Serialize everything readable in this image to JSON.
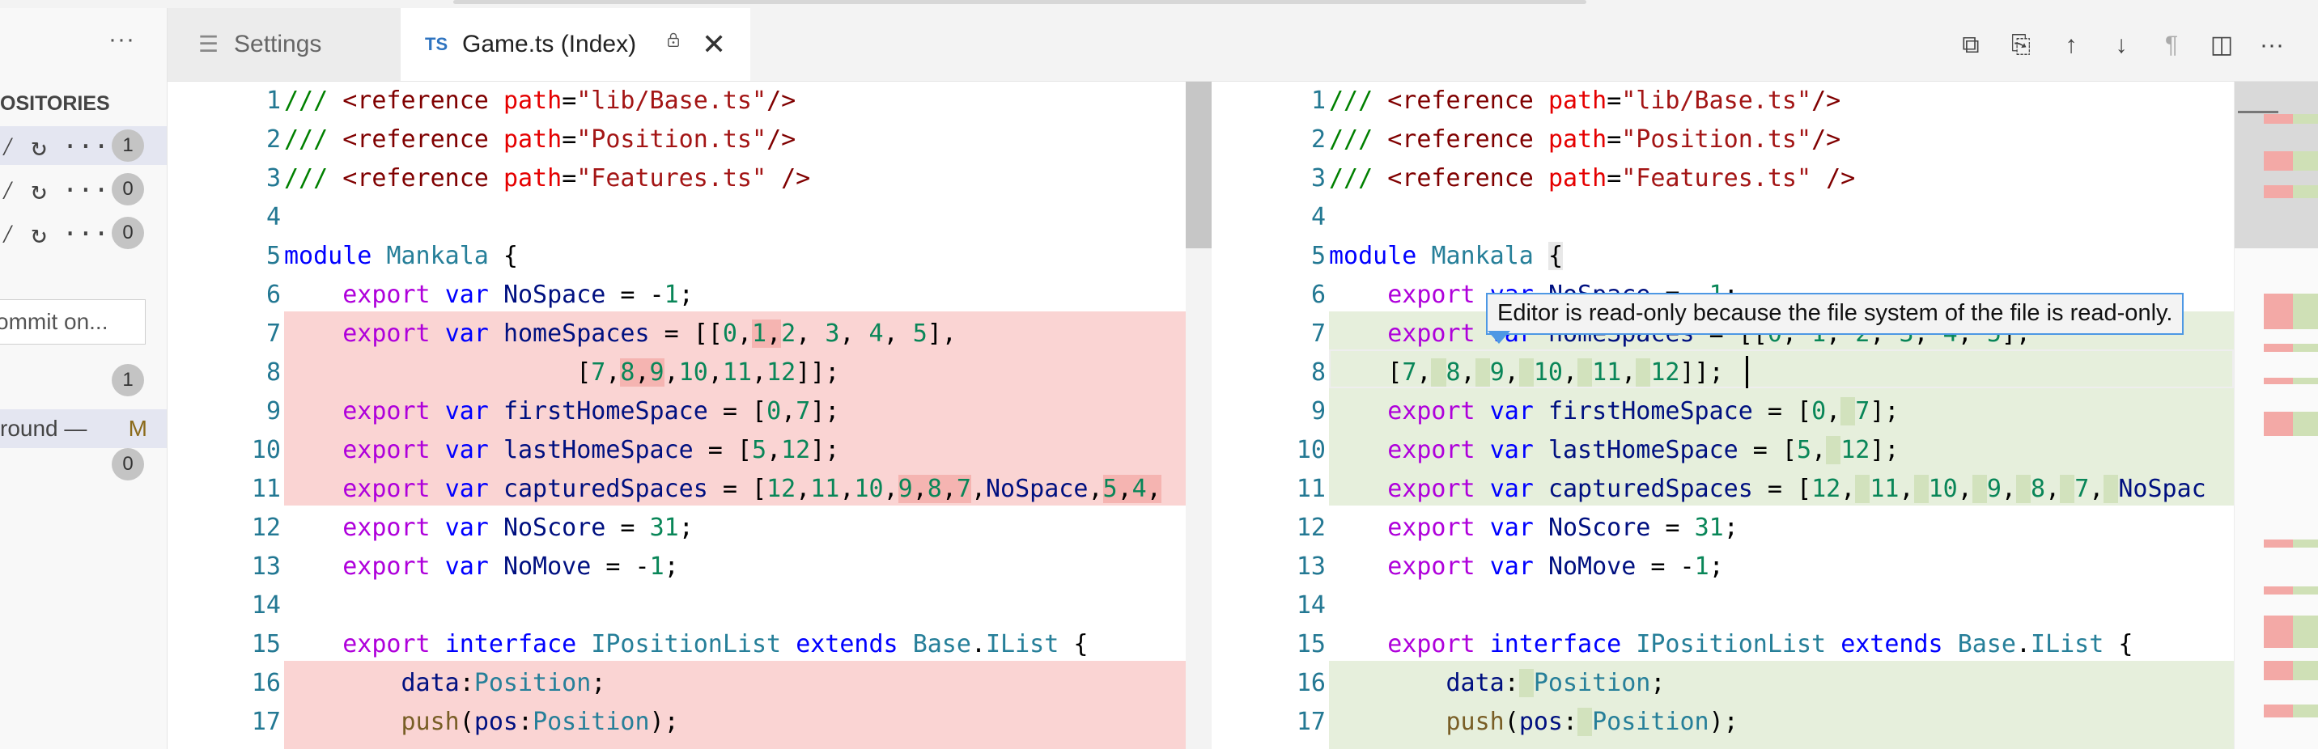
{
  "scm": {
    "more_icon": "ellipsis-icon",
    "title": "OSITORIES",
    "repos": [
      {
        "glyphs": "⁄ ↻ ···",
        "count": "1"
      },
      {
        "glyphs": "⁄ ↻ ···",
        "count": "0"
      },
      {
        "glyphs": "⁄ ↻ ···",
        "count": "0"
      }
    ],
    "commit_placeholder": "ommit on...",
    "staged_count": "1",
    "file_name": "round —",
    "file_status": "M",
    "changes_count": "0"
  },
  "tabs": {
    "settings": "Settings",
    "settings_icon": "☰",
    "game_badge": "TS",
    "game": "Game.ts (Index)",
    "close": "✕"
  },
  "toolbar": {
    "icons": [
      "copy-icon",
      "open-file-icon",
      "arrow-up-icon",
      "arrow-down-icon",
      "pilcrow-icon",
      "split-editor-icon",
      "more-actions-icon"
    ],
    "glyphs": [
      "⧉",
      "⎘",
      "↑",
      "↓",
      "¶",
      "◫",
      "···"
    ]
  },
  "tooltip": {
    "text": "Editor is read-only because the file system of the file is read-only."
  },
  "left": {
    "line_numbers": [
      "1",
      "2",
      "3",
      "4",
      "5",
      "6",
      "7",
      "8",
      "9",
      "10",
      "11",
      "12",
      "13",
      "14",
      "15",
      "16",
      "17"
    ]
  },
  "right": {
    "line_numbers": [
      "1",
      "2",
      "3",
      "4",
      "5",
      "6",
      "7",
      "8",
      "9",
      "10",
      "11",
      "12",
      "13",
      "14",
      "15",
      "16",
      "17"
    ]
  },
  "colors": {
    "deleted_bg": "#fad4d3",
    "inserted_bg": "#e6efdc",
    "tooltip_border": "#4d98e4"
  }
}
